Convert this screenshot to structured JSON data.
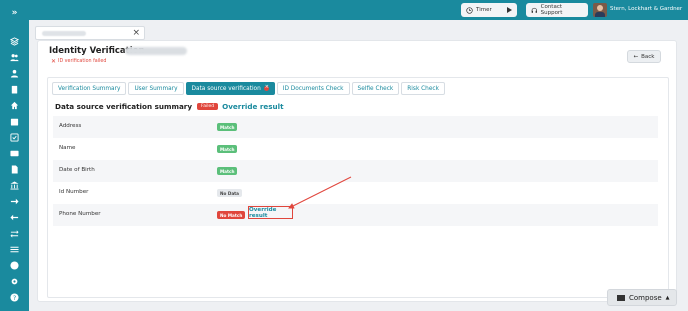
{
  "topbar": {
    "timer_label": "Timer",
    "support_label": "Contact Support",
    "company": "Stern, Lockhart & Gardner"
  },
  "page": {
    "title": "Identity Verification -",
    "status": "ID verification failed",
    "back_label": "Back"
  },
  "tabs": [
    {
      "label": "Verification Summary"
    },
    {
      "label": "User Summary"
    },
    {
      "label": "Data source verification"
    },
    {
      "label": "ID Documents Check"
    },
    {
      "label": "Selfie Check"
    },
    {
      "label": "Risk Check"
    }
  ],
  "summary": {
    "title": "Data source verification summary",
    "failed_badge": "Failed",
    "override_label": "Override result"
  },
  "rows": [
    {
      "label": "Address",
      "status": "Match"
    },
    {
      "label": "Name",
      "status": "Match"
    },
    {
      "label": "Date of Birth",
      "status": "Match"
    },
    {
      "label": "Id Number",
      "status": "No Data"
    },
    {
      "label": "Phone Number",
      "status": "No Match",
      "action": "Override result"
    }
  ],
  "compose": {
    "label": "Compose"
  },
  "colors": {
    "brand": "#1a8a9e",
    "fail": "#e0463c",
    "match": "#5bbf7a"
  }
}
